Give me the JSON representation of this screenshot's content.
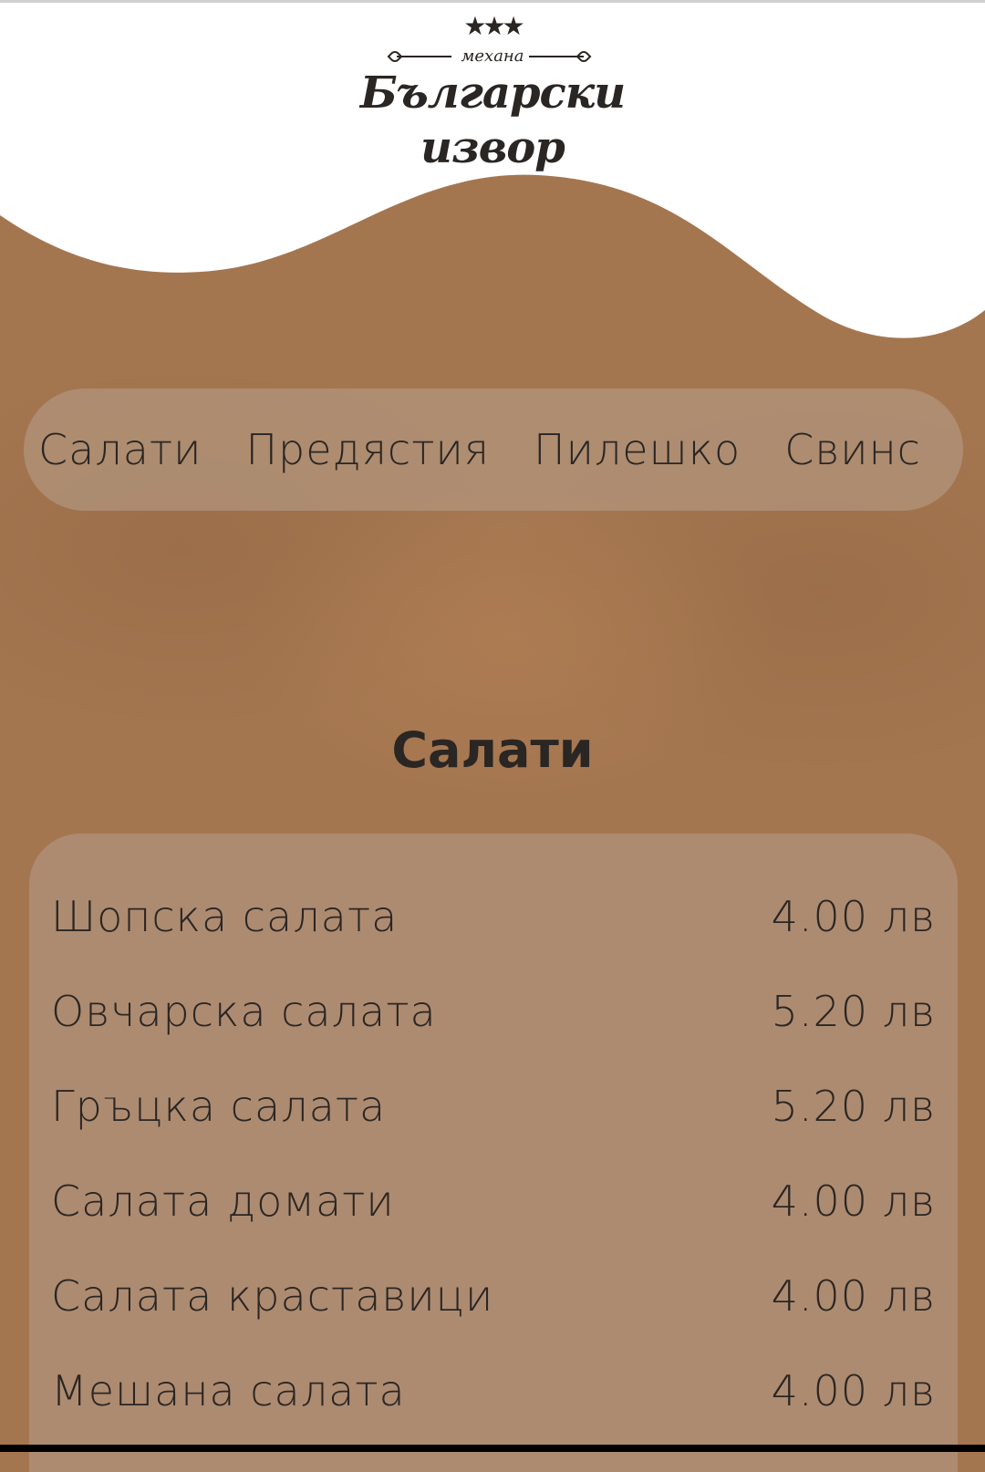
{
  "logo": {
    "stars": "★★★",
    "subtitle": "механа",
    "title": "Български извор"
  },
  "nav": {
    "items": [
      "Салати",
      "Предястия",
      "Пилешко",
      "Свинс"
    ]
  },
  "section": {
    "title": "Салати"
  },
  "menu": {
    "items": [
      {
        "name": "Шопска салата",
        "price": "4.00 лв"
      },
      {
        "name": "Овчарска салата",
        "price": "5.20 лв"
      },
      {
        "name": "Гръцка салата",
        "price": "5.20 лв"
      },
      {
        "name": "Салата домати",
        "price": "4.00 лв"
      },
      {
        "name": "Салата краставици",
        "price": "4.00 лв"
      },
      {
        "name": "Мешана салата",
        "price": "4.00 лв"
      }
    ]
  },
  "colors": {
    "background": "#a47650",
    "text": "#2a2623",
    "header": "#ffffff"
  }
}
